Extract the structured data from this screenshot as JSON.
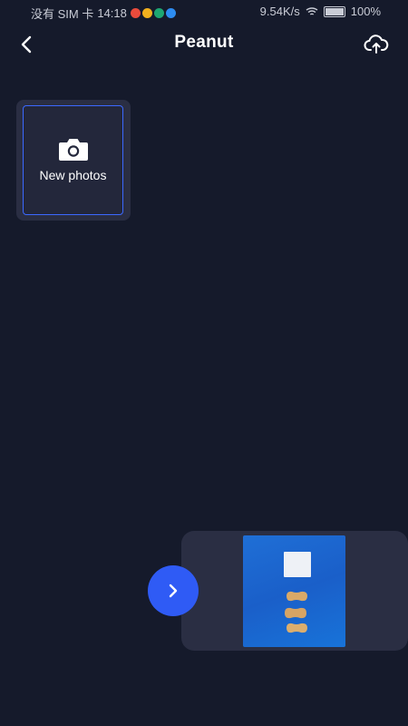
{
  "status_bar": {
    "carrier": "没有 SIM 卡",
    "time": "14:18",
    "speed": "9.54K/s",
    "battery_text": "100%",
    "app_icon_colors": [
      "#e94b3c",
      "#f2b01e",
      "#1ea672",
      "#2d8cf0"
    ]
  },
  "header": {
    "title": "Peanut",
    "back_icon": "chevron-left-icon",
    "upload_icon": "cloud-upload-icon"
  },
  "gallery": {
    "new_photos_label": "New photos",
    "camera_icon": "camera-icon"
  },
  "preview": {
    "next_icon": "chevron-right-icon",
    "thumbnail_subject": "peanuts on blue background"
  },
  "colors": {
    "background": "#151a2b",
    "accent": "#2f5bf5",
    "tile_border": "#3c69ff",
    "panel": "#2a2e43"
  }
}
